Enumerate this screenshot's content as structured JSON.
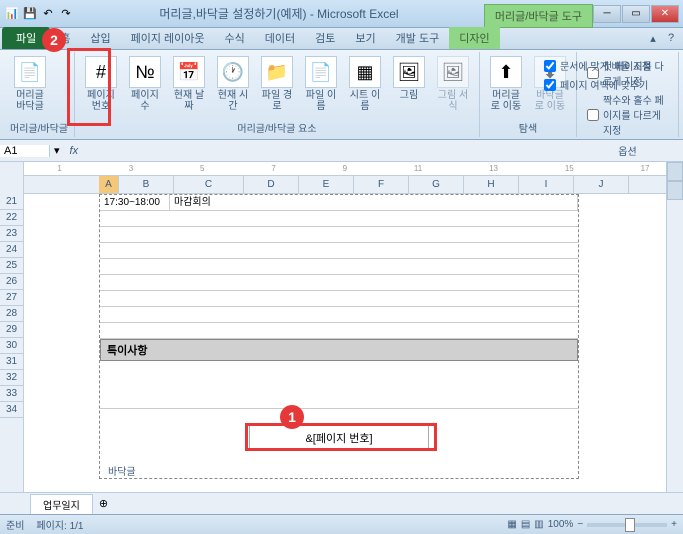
{
  "title": "머리글,바닥글 설정하기(예제) - Microsoft Excel",
  "context_tool": "머리글/바닥글 도구",
  "tabs": {
    "file": "파일",
    "t": [
      "홈",
      "삽입",
      "페이지 레이아웃",
      "수식",
      "데이터",
      "검토",
      "보기",
      "개발 도구",
      "디자인"
    ]
  },
  "ribbon": {
    "btns": {
      "hf": "머리글 바닥글",
      "pnum": "페이지\n번호",
      "pcount": "페이지\n수",
      "cdate": "현재\n날짜",
      "ctime": "현재\n시간",
      "fpath": "파일\n경로",
      "fname": "파일\n이름",
      "sname": "시트\n이름",
      "pic": "그림",
      "picfmt": "그림\n서식",
      "gohdr": "머리글로\n이동",
      "goftr": "바닥글로\n이동"
    },
    "grp": {
      "hf": "머리글/바닥글",
      "elem": "머리글/바닥글 요소",
      "nav": "탐색",
      "opt": "옵션"
    },
    "chk": {
      "c1": "첫 페이지를 다르게 지정",
      "c2": "문서에 맞게 배율 조정",
      "c3": "짝수와 홀수 페이지를 다르게 지정",
      "c4": "페이지 여백에 맞추기"
    }
  },
  "namebox": "A1",
  "cols": [
    "A",
    "B",
    "C",
    "D",
    "E",
    "F",
    "G",
    "H",
    "I",
    "J"
  ],
  "rows": [
    "21",
    "22",
    "23",
    "24",
    "25",
    "26",
    "27",
    "28",
    "29",
    "30",
    "31",
    "32",
    "33",
    "34"
  ],
  "timeslot": "17:30~18:00",
  "meeting": "마감회의",
  "section": "특이사항",
  "footer_code": "&[페이지 번호]",
  "footer_label": "바닥글",
  "sheet_tab": "업무일지",
  "status": {
    "ready": "준비",
    "page": "페이지: 1/1",
    "zoom": "100%"
  },
  "callouts": {
    "c1": "1",
    "c2": "2"
  }
}
